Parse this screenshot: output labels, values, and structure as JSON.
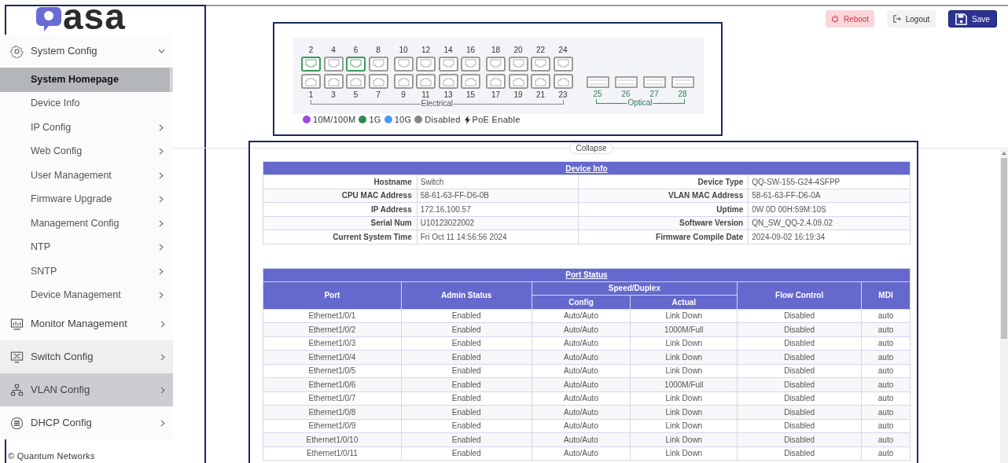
{
  "sidebar": {
    "logo": "asa",
    "items": [
      {
        "label": "System Config",
        "expanded": true,
        "selected": false,
        "hovered": false,
        "children": [
          {
            "label": "System Homepage",
            "selected": true,
            "has_submenu": false
          },
          {
            "label": "Device Info",
            "selected": false,
            "has_submenu": false
          },
          {
            "label": "IP Config",
            "selected": false,
            "has_submenu": true
          },
          {
            "label": "Web Config",
            "selected": false,
            "has_submenu": true
          },
          {
            "label": "User Management",
            "selected": false,
            "has_submenu": true
          },
          {
            "label": "Firmware Upgrade",
            "selected": false,
            "has_submenu": true
          },
          {
            "label": "Management Config",
            "selected": false,
            "has_submenu": true
          },
          {
            "label": "NTP",
            "selected": false,
            "has_submenu": true
          },
          {
            "label": "SNTP",
            "selected": false,
            "has_submenu": true
          },
          {
            "label": "Device Management",
            "selected": false,
            "has_submenu": true
          }
        ]
      },
      {
        "label": "Monitor Management",
        "expanded": false,
        "selected": false,
        "hovered": false
      },
      {
        "label": "Switch Config",
        "expanded": false,
        "selected": false,
        "hovered": true
      },
      {
        "label": "VLAN Config",
        "expanded": false,
        "selected": true,
        "hovered": false
      },
      {
        "label": "DHCP Config",
        "expanded": false,
        "selected": false,
        "hovered": false
      }
    ],
    "footer": "© Quantum Networks"
  },
  "toolbar": {
    "buttons": [
      {
        "label": "Reboot",
        "kind": "reboot"
      },
      {
        "label": "Logout",
        "kind": "logout"
      },
      {
        "label": "Save",
        "kind": "save"
      }
    ]
  },
  "port_panel": {
    "electrical_top": [
      {
        "number": "2",
        "color": "#3a9a5b"
      },
      {
        "number": "4",
        "color": "#9a9a9a"
      },
      {
        "number": "6",
        "color": "#3a9a5b"
      },
      {
        "number": "8",
        "color": "#9a9a9a"
      },
      {
        "number": "10",
        "color": "#9a9a9a"
      },
      {
        "number": "12",
        "color": "#9a9a9a"
      },
      {
        "number": "14",
        "color": "#9a9a9a"
      },
      {
        "number": "16",
        "color": "#9a9a9a"
      },
      {
        "number": "18",
        "color": "#9a9a9a"
      },
      {
        "number": "20",
        "color": "#9a9a9a"
      },
      {
        "number": "22",
        "color": "#9a9a9a"
      },
      {
        "number": "24",
        "color": "#9a9a9a"
      }
    ],
    "electrical_bottom": [
      {
        "number": "1",
        "color": "#9a9a9a"
      },
      {
        "number": "3",
        "color": "#9a9a9a"
      },
      {
        "number": "5",
        "color": "#9a9a9a"
      },
      {
        "number": "7",
        "color": "#9a9a9a"
      },
      {
        "number": "9",
        "color": "#9a9a9a"
      },
      {
        "number": "11",
        "color": "#9a9a9a"
      },
      {
        "number": "13",
        "color": "#9a9a9a"
      },
      {
        "number": "15",
        "color": "#9a9a9a"
      },
      {
        "number": "17",
        "color": "#9a9a9a"
      },
      {
        "number": "19",
        "color": "#9a9a9a"
      },
      {
        "number": "21",
        "color": "#9a9a9a"
      },
      {
        "number": "23",
        "color": "#9a9a9a"
      }
    ],
    "electrical_label": "Electrical",
    "optical": [
      {
        "number": "25",
        "color": "#9a9a9a"
      },
      {
        "number": "26",
        "color": "#9a9a9a"
      },
      {
        "number": "27",
        "color": "#9a9a9a"
      },
      {
        "number": "28",
        "color": "#9a9a9a"
      }
    ],
    "optical_label": "Optical",
    "legend": [
      {
        "label": "10M/100M",
        "kind": "dot",
        "color": "#9b4be0"
      },
      {
        "label": "1G",
        "kind": "dot",
        "color": "#2e8b57"
      },
      {
        "label": "10G",
        "kind": "dot",
        "color": "#4a9af5"
      },
      {
        "label": "Disabled",
        "kind": "dot",
        "color": "#888888"
      },
      {
        "label": "PoE Enable",
        "kind": "bolt"
      }
    ]
  },
  "collapse_label": "Collapse",
  "device_info": {
    "title": "Device Info",
    "rows": [
      [
        "Hostname",
        "Switch",
        "Device Type",
        "QQ-SW-155-G24-4SFPP"
      ],
      [
        "CPU MAC Address",
        "58-61-63-FF-D6-0B",
        "VLAN MAC Address",
        "58-61-63-FF-D6-0A"
      ],
      [
        "IP Address",
        "172.16.100.57",
        "Uptime",
        "0W 0D 00H:59M:10S"
      ],
      [
        "Serial Num",
        "U10123022002",
        "Software Version",
        "QN_SW_QQ-2.4.09.02"
      ],
      [
        "Current System Time",
        "Fri Oct 11 14:56:56 2024",
        "Firmware Compile Date",
        "2024-09-02 16:19:34"
      ]
    ]
  },
  "port_status": {
    "title": "Port Status",
    "header_rows": [
      [
        {
          "label": "Port",
          "rowspan": 2
        },
        {
          "label": "Admin Status",
          "rowspan": 2
        },
        {
          "label": "Speed/Duplex",
          "colspan": 2
        },
        {
          "label": "Flow Control",
          "rowspan": 2
        },
        {
          "label": "MDI",
          "rowspan": 2
        }
      ],
      [
        {
          "label": "Config"
        },
        {
          "label": "Actual"
        }
      ]
    ],
    "rows": [
      [
        "Ethernet1/0/1",
        "Enabled",
        "Auto/Auto",
        "Link Down",
        "Disabled",
        "auto"
      ],
      [
        "Ethernet1/0/2",
        "Enabled",
        "Auto/Auto",
        "1000M/Full",
        "Disabled",
        "auto"
      ],
      [
        "Ethernet1/0/3",
        "Enabled",
        "Auto/Auto",
        "Link Down",
        "Disabled",
        "auto"
      ],
      [
        "Ethernet1/0/4",
        "Enabled",
        "Auto/Auto",
        "Link Down",
        "Disabled",
        "auto"
      ],
      [
        "Ethernet1/0/5",
        "Enabled",
        "Auto/Auto",
        "Link Down",
        "Disabled",
        "auto"
      ],
      [
        "Ethernet1/0/6",
        "Enabled",
        "Auto/Auto",
        "1000M/Full",
        "Disabled",
        "auto"
      ],
      [
        "Ethernet1/0/7",
        "Enabled",
        "Auto/Auto",
        "Link Down",
        "Disabled",
        "auto"
      ],
      [
        "Ethernet1/0/8",
        "Enabled",
        "Auto/Auto",
        "Link Down",
        "Disabled",
        "auto"
      ],
      [
        "Ethernet1/0/9",
        "Enabled",
        "Auto/Auto",
        "Link Down",
        "Disabled",
        "auto"
      ],
      [
        "Ethernet1/0/10",
        "Enabled",
        "Auto/Auto",
        "Link Down",
        "Disabled",
        "auto"
      ],
      [
        "Ethernet1/0/11",
        "Enabled",
        "Auto/Auto",
        "Link Down",
        "Disabled",
        "auto"
      ]
    ]
  }
}
